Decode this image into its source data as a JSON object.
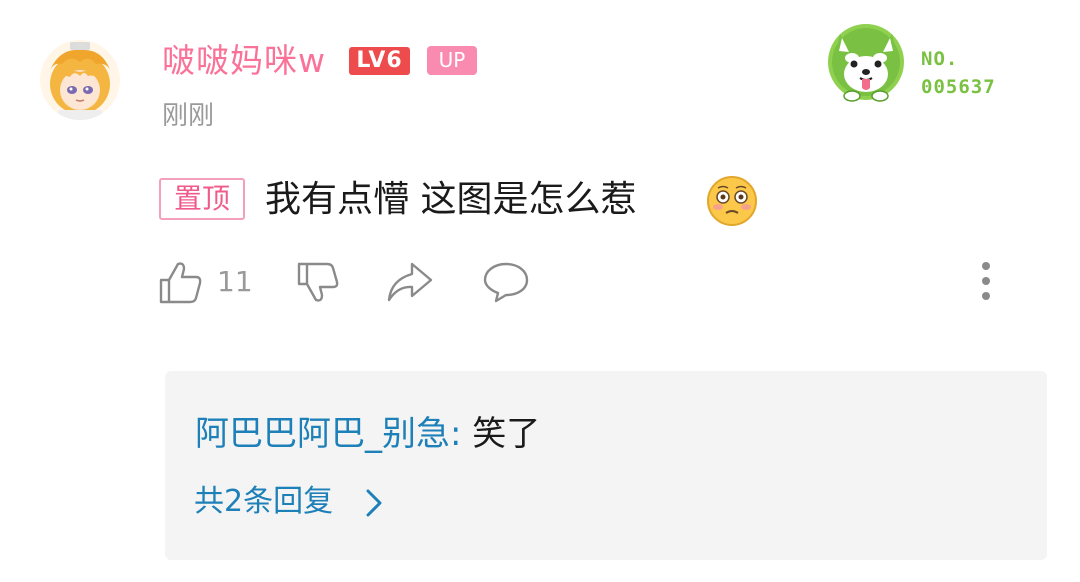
{
  "comment": {
    "username": "啵啵妈咪w",
    "level_badge": "LV6",
    "up_badge": "UP",
    "time": "刚刚",
    "pin_tag": "置顶",
    "text": "我有点懵  这图是怎么惹",
    "emoji": "dizzy-face-emoji",
    "like_count": "11"
  },
  "fan_badge": {
    "label": "NO.",
    "number": "005637",
    "color": "#7ac143"
  },
  "replies": {
    "first_reply_author": "阿巴巴阿巴_别急",
    "first_reply_colon": ": ",
    "first_reply_text": "笑了",
    "view_all_label": "共2条回复"
  },
  "colors": {
    "username": "#fb7299",
    "level_badge": "#ee4c4c",
    "up_badge": "#f98ab0",
    "link": "#1e80b8",
    "muted": "#9a9a9a",
    "reply_bg": "#f4f4f4"
  },
  "icons": {
    "like": "thumbs-up-icon",
    "dislike": "thumbs-down-icon",
    "share": "share-icon",
    "reply": "reply-bubble-icon",
    "more": "more-vertical-icon",
    "chevron": "chevron-right-icon"
  }
}
